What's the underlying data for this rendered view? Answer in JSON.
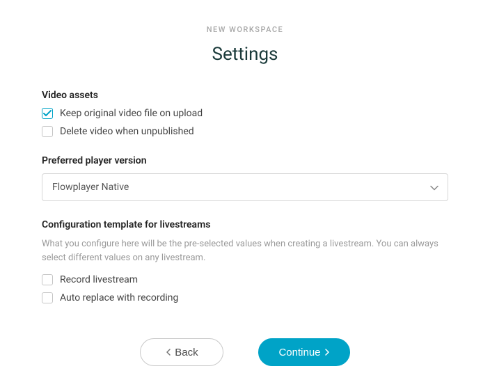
{
  "colors": {
    "accent": "#00a3c7",
    "text": "#333333",
    "muted": "#9a9a9a",
    "border": "#d6d6d6"
  },
  "header": {
    "eyebrow": "NEW WORKSPACE",
    "title": "Settings"
  },
  "video_assets": {
    "heading": "Video assets",
    "options": [
      {
        "label": "Keep original video file on upload",
        "checked": true
      },
      {
        "label": "Delete video when unpublished",
        "checked": false
      }
    ]
  },
  "player_version": {
    "heading": "Preferred player version",
    "selected": "Flowplayer Native"
  },
  "livestream_template": {
    "heading": "Configuration template for livestreams",
    "helper": "What you configure here will be the pre-selected values when creating a livestream. You can always select different values on any livestream.",
    "options": [
      {
        "label": "Record livestream",
        "checked": false
      },
      {
        "label": "Auto replace with recording",
        "checked": false
      }
    ]
  },
  "buttons": {
    "back": "Back",
    "continue": "Continue"
  }
}
